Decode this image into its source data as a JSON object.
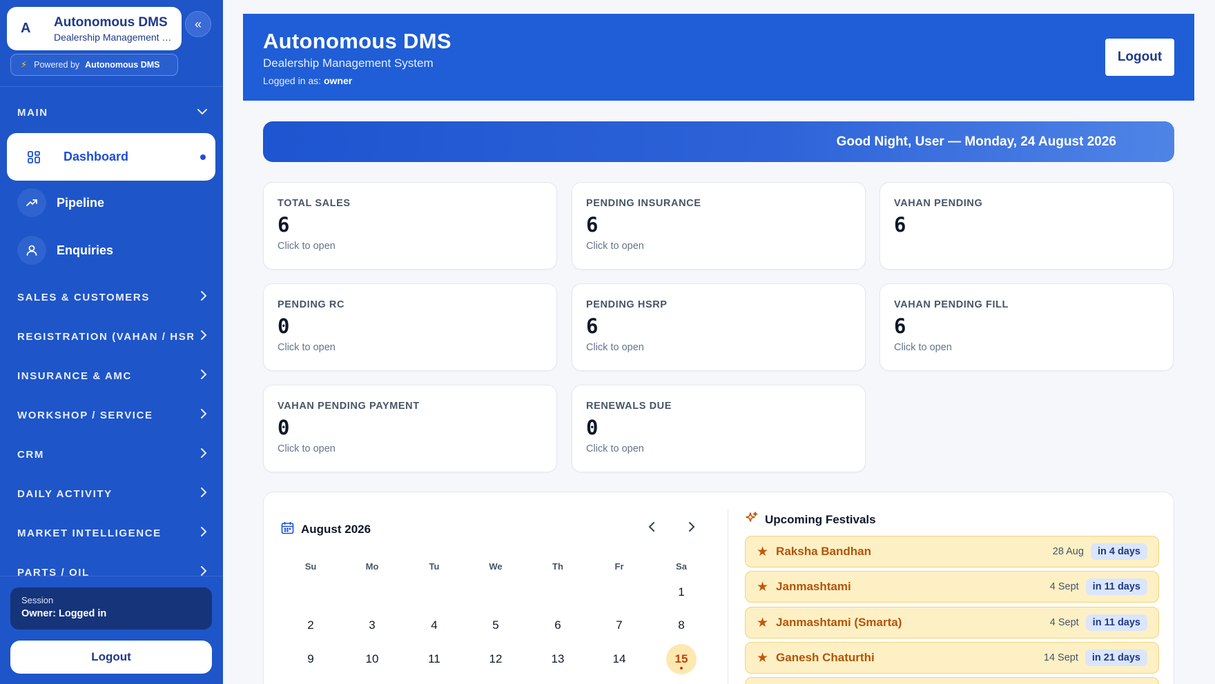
{
  "sidebar": {
    "brand": {
      "avatar": "A",
      "title": "Autonomous DMS",
      "subtitle": "Dealership Management System"
    },
    "collapse_icon": "double-chevron-left-icon",
    "powered": {
      "prefix": "Powered by",
      "name": "Autonomous DMS"
    },
    "sections": {
      "main": "MAIN",
      "sales": "SALES & CUSTOMERS",
      "registration": "REGISTRATION (VAHAN / HSRP)",
      "insurance": "INSURANCE & AMC",
      "workshop": "WORKSHOP / SERVICE",
      "crm": "CRM",
      "daily": "DAILY ACTIVITY",
      "market": "MARKET INTELLIGENCE",
      "parts": "PARTS / OIL"
    },
    "nav": {
      "dashboard": "Dashboard",
      "pipeline": "Pipeline",
      "enquiries": "Enquiries"
    },
    "session": {
      "label": "Session",
      "value": "Owner: Logged in"
    },
    "logout": "Logout"
  },
  "header": {
    "title": "Autonomous DMS",
    "subtitle": "Dealership Management System",
    "user_prefix": "Logged in as:",
    "user": "owner",
    "logout": "Logout"
  },
  "greeting": "Good Night, User — Monday, 24 August 2026",
  "stats": [
    {
      "label": "TOTAL SALES",
      "value": "6",
      "hint": "Click to open"
    },
    {
      "label": "PENDING INSURANCE",
      "value": "6",
      "hint": "Click to open"
    },
    {
      "label": "VAHAN PENDING",
      "value": "6",
      "hint": ""
    },
    {
      "label": "PENDING RC",
      "value": "0",
      "hint": "Click to open"
    },
    {
      "label": "PENDING HSRP",
      "value": "6",
      "hint": "Click to open"
    },
    {
      "label": "VAHAN PENDING FILL",
      "value": "6",
      "hint": "Click to open"
    },
    {
      "label": "VAHAN PENDING PAYMENT",
      "value": "0",
      "hint": "Click to open"
    },
    {
      "label": "RENEWALS DUE",
      "value": "0",
      "hint": "Click to open"
    }
  ],
  "calendar": {
    "title": "August 2026",
    "weekdays": [
      "Su",
      "Mo",
      "Tu",
      "We",
      "Th",
      "Fr",
      "Sa"
    ],
    "days": [
      "1",
      "2",
      "3",
      "4",
      "5",
      "6",
      "7",
      "8",
      "9",
      "10",
      "11",
      "12",
      "13",
      "14",
      "15"
    ],
    "highlighted_day": "15"
  },
  "festivals": {
    "title": "Upcoming Festivals",
    "items": [
      {
        "name": "Raksha Bandhan",
        "date": "28 Aug",
        "badge": "in 4 days"
      },
      {
        "name": "Janmashtami",
        "date": "4 Sept",
        "badge": "in 11 days"
      },
      {
        "name": "Janmashtami (Smarta)",
        "date": "4 Sept",
        "badge": "in 11 days"
      },
      {
        "name": "Ganesh Chaturthi",
        "date": "14 Sept",
        "badge": "in 21 days"
      }
    ]
  },
  "colors": {
    "sidebar_bg": "#1e55c8",
    "header_bg": "#1f5ed6",
    "accent": "#1d4ed8",
    "festival_bg": "#fdf0c4",
    "festival_text": "#b4530a"
  }
}
